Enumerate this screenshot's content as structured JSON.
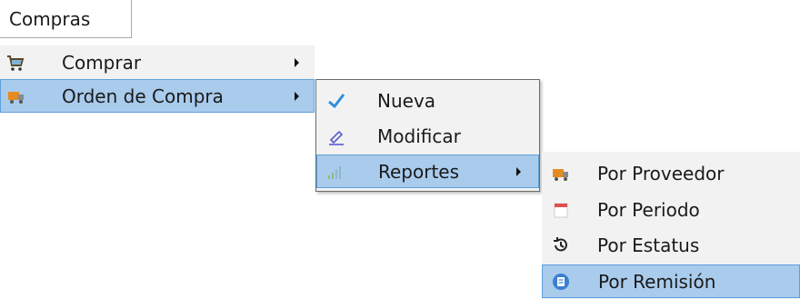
{
  "topmenu": {
    "label": "Compras"
  },
  "menu_compras": {
    "items": [
      {
        "label": "Comprar",
        "icon": "shopping-cart-icon",
        "has_submenu": true
      },
      {
        "label": "Orden de Compra",
        "icon": "truck-box-icon",
        "has_submenu": true,
        "highlighted": true
      }
    ]
  },
  "menu_orden": {
    "items": [
      {
        "label": "Nueva",
        "icon": "checkmark-icon"
      },
      {
        "label": "Modificar",
        "icon": "pencil-icon"
      },
      {
        "label": "Reportes",
        "icon": "bar-chart-icon",
        "has_submenu": true,
        "highlighted": true
      }
    ]
  },
  "menu_reportes": {
    "items": [
      {
        "label": "Por Proveedor",
        "icon": "truck-box-icon"
      },
      {
        "label": "Por Periodo",
        "icon": "calendar-icon"
      },
      {
        "label": "Por Estatus",
        "icon": "history-icon"
      },
      {
        "label": "Por Remisión",
        "icon": "document-badge-icon",
        "highlighted": true
      }
    ]
  },
  "colors": {
    "menu_bg": "#f2f2f2",
    "highlight_bg": "#a9cbec",
    "highlight_border": "#5ea0dd",
    "submenu_border": "#6b6b6b"
  }
}
